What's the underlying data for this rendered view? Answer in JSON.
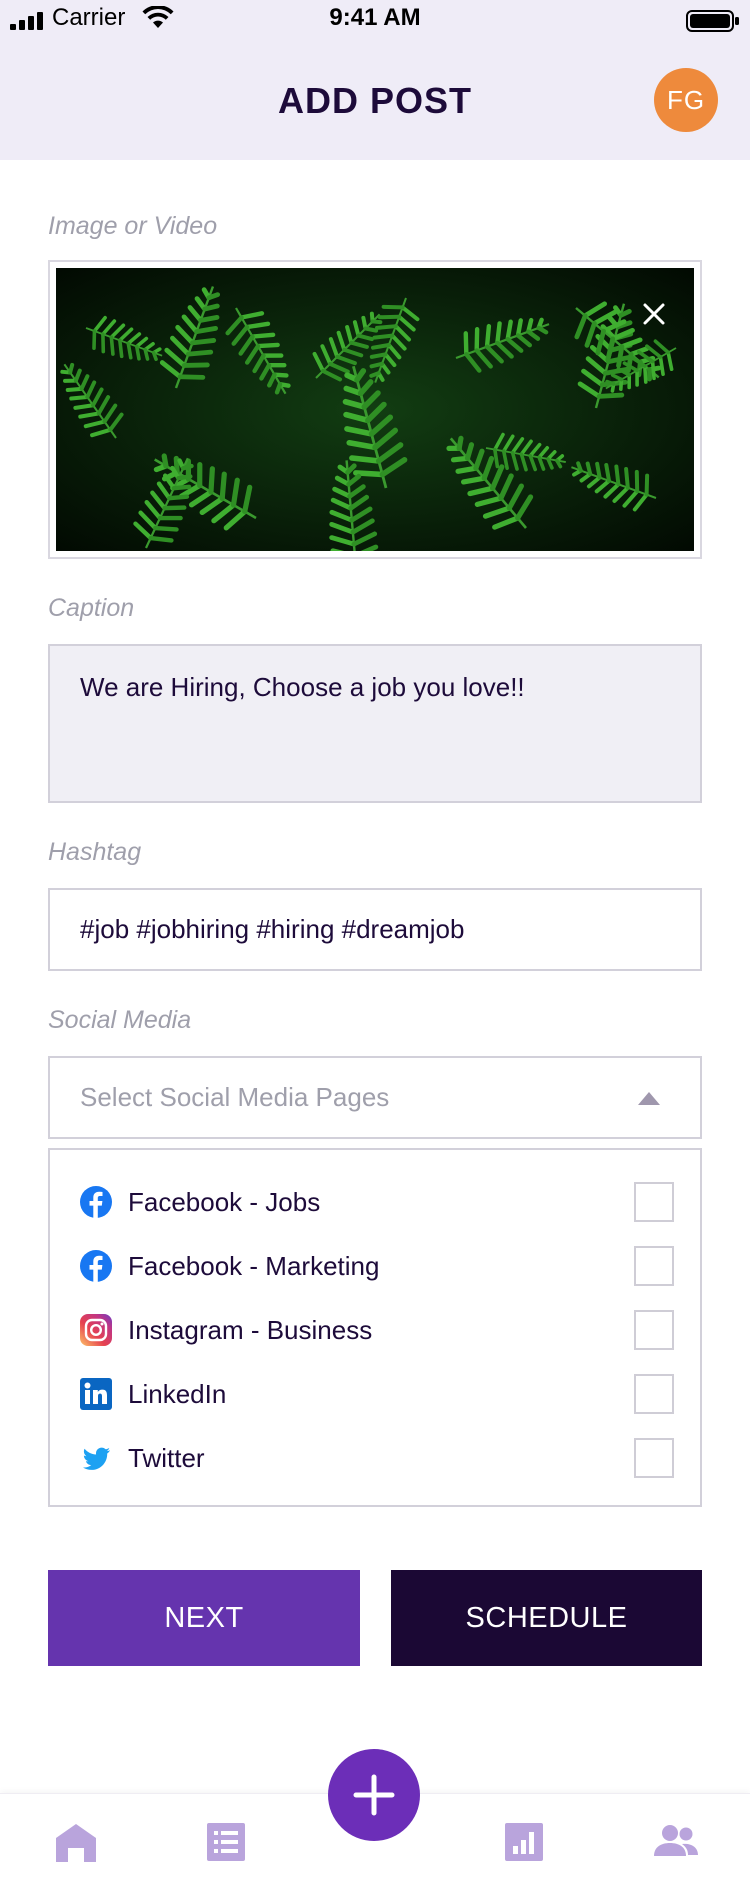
{
  "status_bar": {
    "carrier": "Carrier",
    "time": "9:41 AM"
  },
  "header": {
    "title": "ADD POST",
    "avatar_initials": "FG",
    "avatar_color": "#ee8a3c"
  },
  "form": {
    "media": {
      "label": "Image or Video",
      "image": "fern-leaves-photo",
      "remove_icon": "close-icon"
    },
    "caption": {
      "label": "Caption",
      "value": "We are Hiring, Choose a job you love!!"
    },
    "hashtag": {
      "label": "Hashtag",
      "value": "#job #jobhiring #hiring #dreamjob"
    },
    "social_media": {
      "label": "Social Media",
      "placeholder": "Select Social Media Pages",
      "options": [
        {
          "label": "Facebook - Jobs",
          "icon": "facebook-icon",
          "checked": false
        },
        {
          "label": "Facebook - Marketing",
          "icon": "facebook-icon",
          "checked": false
        },
        {
          "label": "Instagram - Business",
          "icon": "instagram-icon",
          "checked": false
        },
        {
          "label": "LinkedIn",
          "icon": "linkedin-icon",
          "checked": false
        },
        {
          "label": "Twitter",
          "icon": "twitter-icon",
          "checked": false
        }
      ]
    }
  },
  "actions": {
    "next_label": "NEXT",
    "schedule_label": "SCHEDULE"
  },
  "tabbar": {
    "tabs": [
      "home-icon",
      "list-icon",
      "add-icon",
      "analytics-icon",
      "people-icon"
    ],
    "accent": "#6c2eb8",
    "inactive": "#b9a4dc"
  },
  "colors": {
    "primary": "#6534ae",
    "dark": "#1b0834",
    "header_bg": "#efecf7"
  }
}
